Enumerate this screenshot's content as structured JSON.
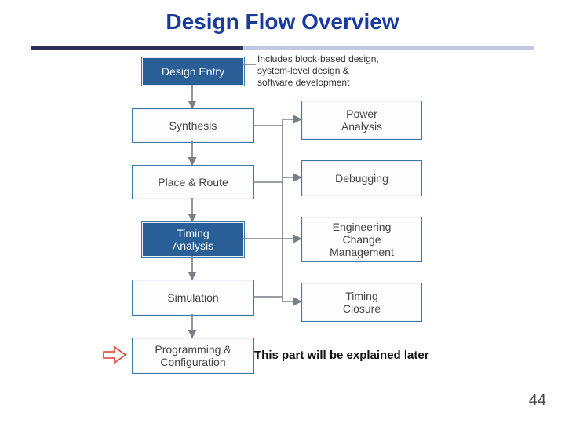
{
  "title": "Design Flow Overview",
  "annotation": "Includes block-based design,\nsystem-level design &\nsoftware development",
  "left_boxes": {
    "design_entry": "Design Entry",
    "synthesis": "Synthesis",
    "place_route": "Place & Route",
    "timing_analysis": "Timing\nAnalysis",
    "simulation": "Simulation",
    "programming": "Programming &\nConfiguration"
  },
  "right_boxes": {
    "power": "Power\nAnalysis",
    "debugging": "Debugging",
    "ecm": "Engineering\nChange\nManagement",
    "timing_closure": "Timing\nClosure"
  },
  "caption": "This part will be explained later",
  "page_number": "44"
}
